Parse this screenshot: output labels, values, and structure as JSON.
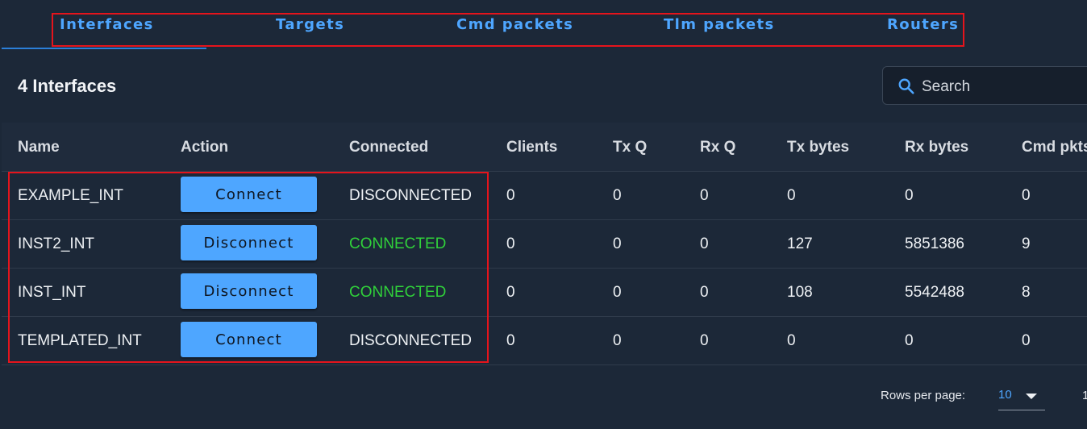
{
  "tabs": [
    {
      "label": "Interfaces"
    },
    {
      "label": "Targets"
    },
    {
      "label": "Cmd packets"
    },
    {
      "label": "Tlm packets"
    },
    {
      "label": "Routers"
    }
  ],
  "card": {
    "title": "4 Interfaces",
    "search_placeholder": "Search"
  },
  "table": {
    "headers": [
      "Name",
      "Action",
      "Connected",
      "Clients",
      "Tx Q",
      "Rx Q",
      "Tx bytes",
      "Rx bytes",
      "Cmd pkts"
    ],
    "rows": [
      {
        "name": "EXAMPLE_INT",
        "action": "Connect",
        "connected": "DISCONNECTED",
        "clients": "0",
        "txq": "0",
        "rxq": "0",
        "txbytes": "0",
        "rxbytes": "0",
        "cmdpkts": "0"
      },
      {
        "name": "INST2_INT",
        "action": "Disconnect",
        "connected": "CONNECTED",
        "clients": "0",
        "txq": "0",
        "rxq": "0",
        "txbytes": "127",
        "rxbytes": "5851386",
        "cmdpkts": "9"
      },
      {
        "name": "INST_INT",
        "action": "Disconnect",
        "connected": "CONNECTED",
        "clients": "0",
        "txq": "0",
        "rxq": "0",
        "txbytes": "108",
        "rxbytes": "5542488",
        "cmdpkts": "8"
      },
      {
        "name": "TEMPLATED_INT",
        "action": "Connect",
        "connected": "DISCONNECTED",
        "clients": "0",
        "txq": "0",
        "rxq": "0",
        "txbytes": "0",
        "rxbytes": "0",
        "cmdpkts": "0"
      }
    ]
  },
  "footer": {
    "rows_per_page_label": "Rows per page:",
    "rows_per_page_value": "10",
    "page_info": "1"
  },
  "colors": {
    "accent": "#4ea6ff",
    "connected": "#30d13a",
    "highlight": "#e5141c",
    "background": "#1c2838"
  }
}
